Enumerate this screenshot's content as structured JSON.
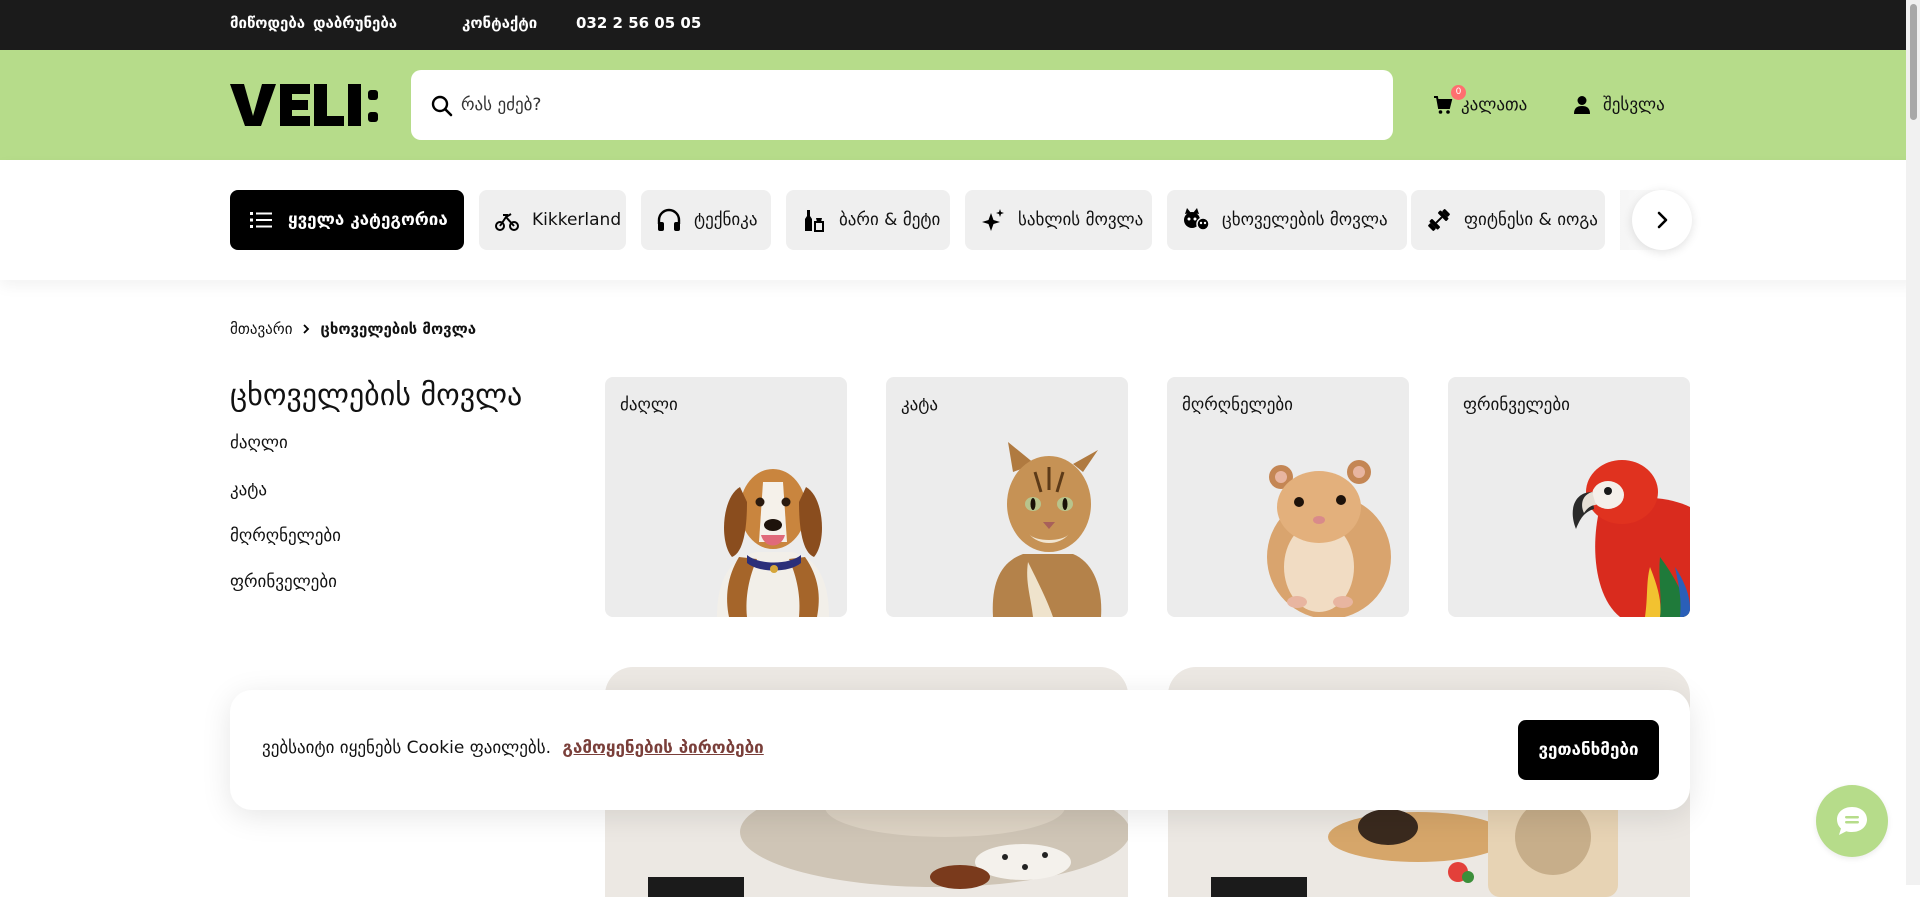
{
  "topbar": {
    "links": [
      "მიწოდება",
      "დაბრუნება",
      "კონტაქტი"
    ],
    "phone": "032 2 56 05 05"
  },
  "header": {
    "logo_text": "VELI:",
    "search_placeholder": "რას ეძებ?",
    "cart_label": "კალათა",
    "cart_count": "0",
    "login_label": "შესვლა"
  },
  "nav": {
    "all_categories": "ყველა კატეგორია",
    "chips": [
      {
        "label": "Kikkerland",
        "icon": "kikkerland-icon"
      },
      {
        "label": "ტექნიკა",
        "icon": "headphones-icon"
      },
      {
        "label": "ბარი & მეტი",
        "icon": "bar-bottles-icon"
      },
      {
        "label": "სახლის მოვლა",
        "icon": "sparkle-icon"
      },
      {
        "label": "ცხოველების მოვლა",
        "icon": "pet-icon"
      },
      {
        "label": "ფიტნესი & იოგა",
        "icon": "dumbbell-icon"
      }
    ]
  },
  "breadcrumb": {
    "home": "მთავარი",
    "current": "ცხოველების მოვლა"
  },
  "page": {
    "title": "ცხოველების მოვლა",
    "sidebar": [
      "ძაღლი",
      "კატა",
      "მღრღნელები",
      "ფრინველები"
    ],
    "cards": [
      {
        "label": "ძაღლი",
        "image": "beagle-dog"
      },
      {
        "label": "კატა",
        "image": "tabby-cat"
      },
      {
        "label": "მღრღნელები",
        "image": "hamster"
      },
      {
        "label": "ფრინველები",
        "image": "red-macaw-parrot"
      }
    ]
  },
  "cookie": {
    "text": "ვებსაიტი იყენებს Cookie ფაილებს.",
    "link": "გამოყენების პირობები",
    "accept": "ვეთანხმები"
  },
  "colors": {
    "brand_green": "#b6dc8a",
    "topbar": "#1b1b1b",
    "chip_bg": "#efefef",
    "card_bg": "#ececec",
    "link_brown": "#7a3f3a",
    "badge": "#ff6f6f"
  }
}
